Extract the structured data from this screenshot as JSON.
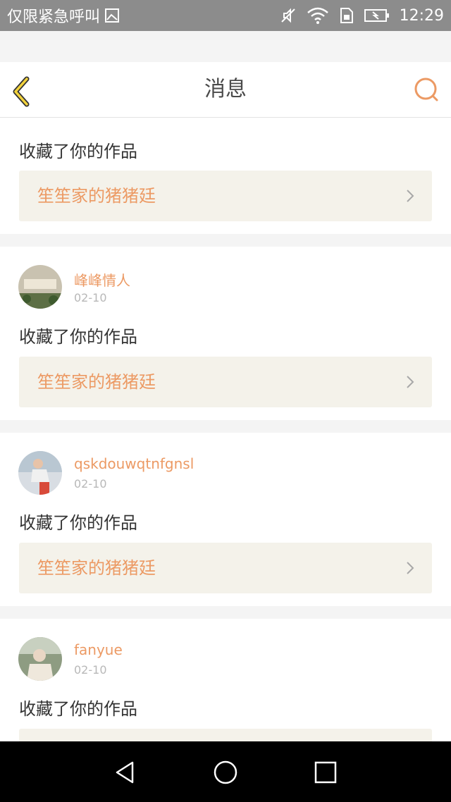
{
  "status_bar": {
    "carrier_text": "仅限紧急呼叫",
    "time": "12:29",
    "icons": [
      "image-icon",
      "mute-icon",
      "wifi-icon",
      "sim-icon",
      "battery-icon"
    ]
  },
  "header": {
    "title": "消息",
    "back_icon": "chevron-left-icon",
    "search_icon": "search-icon",
    "accent_color": "#ec9a64"
  },
  "messages": [
    {
      "username": "",
      "date": "",
      "action": "收藏了你的作品",
      "work_title": "笙笙家的猪猪廷"
    },
    {
      "username": "峰峰情人",
      "date": "02-10",
      "action": "收藏了你的作品",
      "work_title": "笙笙家的猪猪廷"
    },
    {
      "username": "qskdouwqtnfgnsl",
      "date": "02-10",
      "action": "收藏了你的作品",
      "work_title": "笙笙家的猪猪廷"
    },
    {
      "username": "fanyue",
      "date": "02-10",
      "action": "收藏了你的作品",
      "work_title": ""
    }
  ],
  "nav_bar": {
    "icons": [
      "back-triangle-icon",
      "home-circle-icon",
      "recents-square-icon"
    ]
  }
}
